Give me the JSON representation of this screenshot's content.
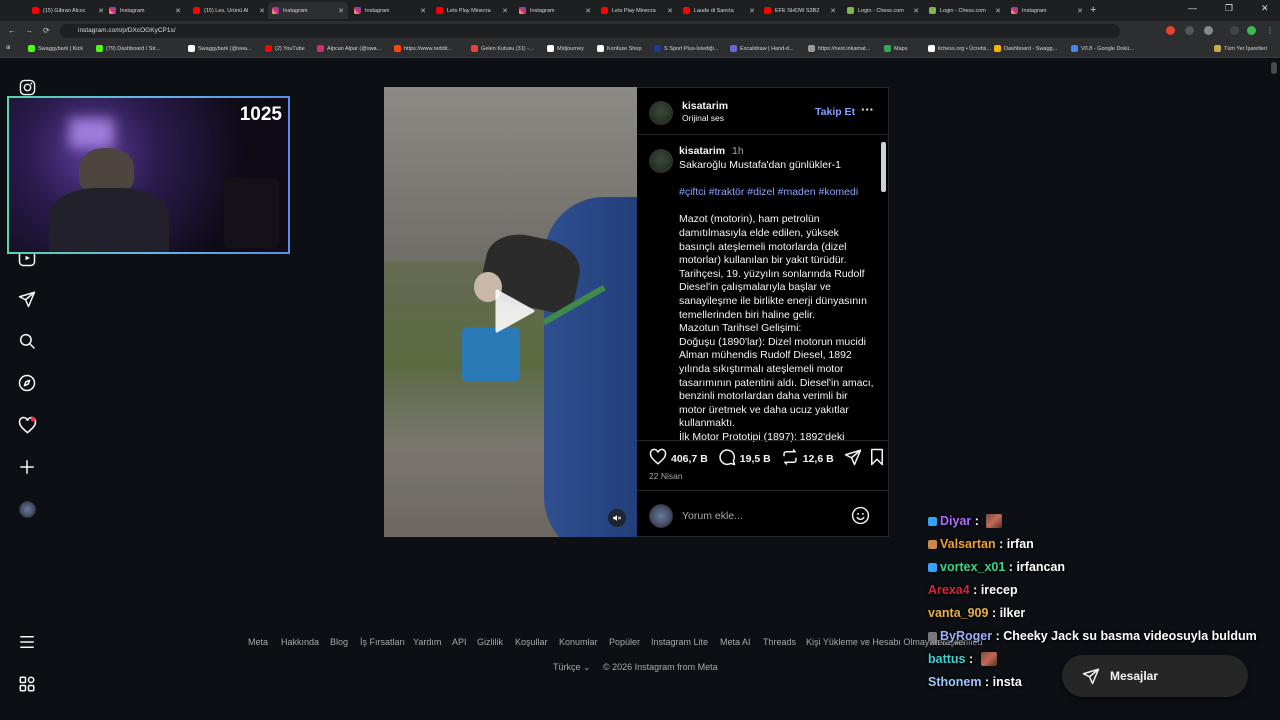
{
  "browser": {
    "tabs": [
      {
        "title": "(15) Gibran Alcoc",
        "icon": "youtube-icon",
        "kind": "yt"
      },
      {
        "title": "Instagram",
        "icon": "instagram-icon",
        "kind": "ig"
      },
      {
        "title": "(15) Les, Ürünü Al",
        "icon": "youtube-icon",
        "kind": "yt"
      },
      {
        "title": "Instagram",
        "icon": "instagram-icon",
        "kind": "ig",
        "active": true
      },
      {
        "title": "Instagram",
        "icon": "instagram-icon",
        "kind": "ig"
      },
      {
        "title": "Lets Play Minecra",
        "icon": "youtube-icon",
        "kind": "yt"
      },
      {
        "title": "Instagram",
        "icon": "instagram-icon",
        "kind": "ig"
      },
      {
        "title": "Lets Play Minecra",
        "icon": "youtube-icon",
        "kind": "yt"
      },
      {
        "title": "Laude di Sancta",
        "icon": "youtube-icon",
        "kind": "yt"
      },
      {
        "title": "EFE SHOW S3B2",
        "icon": "youtube-icon",
        "kind": "yt"
      },
      {
        "title": "Login - Chess.com",
        "icon": "chess-icon",
        "kind": "cc"
      },
      {
        "title": "Login - Chess.com",
        "icon": "chess-icon",
        "kind": "cc"
      },
      {
        "title": "Instagram",
        "icon": "instagram-icon",
        "kind": "ig"
      }
    ],
    "url": "instagram.com/p/DXcOGKyCP1s/",
    "bookmarks": [
      {
        "label": "Swaggybark | Kick",
        "color": "#53fc18"
      },
      {
        "label": "(79) Dashboard / Str...",
        "color": "#53fc18"
      },
      {
        "label": "Swaggybark (@swa...",
        "color": "#ffffff"
      },
      {
        "label": "(2) YouTube",
        "color": "#ff0000"
      },
      {
        "label": "Alpcan Alpar (@swa...",
        "color": "#d62976"
      },
      {
        "label": "https://www.reddit...",
        "color": "#ff4500"
      },
      {
        "label": "Gelen Kutusu (31) -...",
        "color": "#ea4335"
      },
      {
        "label": "Midjourney",
        "color": "#ffffff"
      },
      {
        "label": "Konfuse Shop",
        "color": "#ffffff"
      },
      {
        "label": "S Sport Plus-İstediği...",
        "color": "#1e3a8a"
      },
      {
        "label": "Excalidraw | Hand-d...",
        "color": "#6965db"
      },
      {
        "label": "https://next.inkamat...",
        "color": "#999999"
      },
      {
        "label": "Maps",
        "color": "#34a853"
      },
      {
        "label": "lichess.org • Ücretsi...",
        "color": "#ffffff"
      },
      {
        "label": "Dashboard - Swagg...",
        "color": "#f4b400"
      },
      {
        "label": "V0.8 - Google Dokü...",
        "color": "#4285f4"
      }
    ],
    "all_bookmarks": "Tüm Yer İşaretleri"
  },
  "sidebar": {
    "icons": [
      "instagram-icon",
      "reels-icon",
      "direct-icon",
      "search-icon",
      "explore-icon",
      "notifications-icon",
      "create-icon",
      "profile-icon"
    ],
    "bottom_icons": [
      "menu-icon",
      "more-apps-icon"
    ]
  },
  "webcam": {
    "count": "1025"
  },
  "post": {
    "username": "kisatarim",
    "audio": "Orijinal ses",
    "follow_label": "Takip Et",
    "caption_username": "kisatarim",
    "caption_time": "1h",
    "caption_title": "Sakaroğlu Mustafa'dan günlükler-1",
    "hashtags": "#çiftci #traktör #dizel #maden #komedi",
    "caption_paragraphs": [
      "Mazot (motorin), ham petrolün damıtılmasıyla elde edilen, yüksek basınçlı ateşlemeli motorlarda (dizel motorlar) kullanılan bir yakıt türüdür. Tarihçesi, 19. yüzyılın sonlarında Rudolf Diesel'in çalışmalarıyla başlar ve sanayileşme ile birlikte enerji dünyasının temellerinden biri haline gelir.",
      "Mazotun Tarihsel Gelişimi:",
      "Doğuşu (1890'lar): Dizel motorun mucidi Alman mühendis Rudolf Diesel, 1892 yılında sıkıştırmalı ateşlemeli motor tasarımının patentini aldı. Diesel'in amacı, benzinli motorlardan daha verimli bir motor üretmek ve daha ucuz yakıtlar kullanmaktı.",
      "İlk Motor Prototipi (1897): 1892'deki"
    ],
    "likes": "406,7 B",
    "comments": "19,5 B",
    "reposts": "12,6 B",
    "date": "22 Nisan",
    "comment_placeholder": "Yorum ekle..."
  },
  "footer": {
    "links": [
      "Meta",
      "Hakkında",
      "Blog",
      "İş Fırsatları",
      "Yardım",
      "API",
      "Gizlilik",
      "Koşullar",
      "Konumlar",
      "Popüler",
      "Instagram Lite",
      "Meta AI",
      "Threads",
      "Kişi Yükleme ve Hesabı Olmayan Kişiler",
      "Meta Verified"
    ],
    "language": "Türkçe",
    "copyright": "© 2026 Instagram from Meta"
  },
  "chat": [
    {
      "user": "Diyar",
      "color": "#b06aff",
      "message": "",
      "emote": true
    },
    {
      "user": "Valsartan",
      "color": "#f0a030",
      "message": "irfan",
      "emote": false
    },
    {
      "user": "vortex_x01",
      "color": "#3ad68a",
      "message": "irfancan",
      "emote": false
    },
    {
      "user": "Arexa4",
      "color": "#e0223c",
      "message": "irecep",
      "emote": false
    },
    {
      "user": "vanta_909",
      "color": "#e8b040",
      "message": "ilker",
      "emote": false
    },
    {
      "user": "ByRoger",
      "color": "#9ab0ff",
      "message": "Cheeky Jack su basma videosuyla buldum",
      "emote": false
    },
    {
      "user": "battus",
      "color": "#3ad6d6",
      "message": "",
      "emote": true
    },
    {
      "user": "Sthonem",
      "color": "#9ec8ff",
      "message": "insta",
      "emote": false
    }
  ],
  "messages_button": "Mesajlar"
}
